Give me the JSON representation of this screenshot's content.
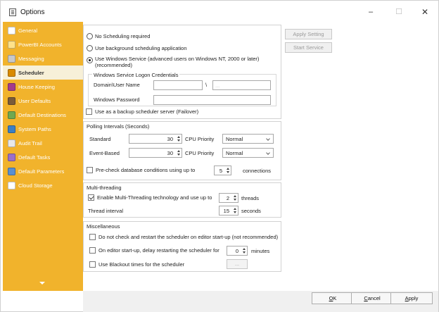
{
  "window": {
    "title": "Options",
    "minimize": "–",
    "maximize": "☐",
    "close": "✕"
  },
  "sidebar": {
    "items": [
      {
        "label": "General",
        "icon": "general-icon",
        "color": "#ffffff"
      },
      {
        "label": "PowerBI Accounts",
        "icon": "powerbi-icon",
        "color": "#ffe28a"
      },
      {
        "label": "Messaging",
        "icon": "messaging-icon",
        "color": "#c8c8c8"
      },
      {
        "label": "Scheduler",
        "icon": "clock-icon",
        "color": "#d98a00"
      },
      {
        "label": "House Keeping",
        "icon": "broom-icon",
        "color": "#a43c8c"
      },
      {
        "label": "User Defaults",
        "icon": "users-icon",
        "color": "#7a5b3a"
      },
      {
        "label": "Default Destinations",
        "icon": "destinations-icon",
        "color": "#6fa850"
      },
      {
        "label": "System Paths",
        "icon": "paths-icon",
        "color": "#3b7fc4"
      },
      {
        "label": "Audit Trail",
        "icon": "audit-icon",
        "color": "#e8e8e8"
      },
      {
        "label": "Default Tasks",
        "icon": "tasks-icon",
        "color": "#9b6fc8"
      },
      {
        "label": "Default Parameters",
        "icon": "parameters-icon",
        "color": "#5a8fd0"
      },
      {
        "label": "Cloud Storage",
        "icon": "cloud-icon",
        "color": "#ffffff"
      }
    ],
    "active": "Scheduler"
  },
  "scheduling": {
    "option_none": "No Scheduling required",
    "option_background": "Use background scheduling application",
    "option_service_line1": "Use Windows Service (advanced users on Windows NT, 2000 or later)",
    "option_service_line2": "(recommended)",
    "selected": "service",
    "credentials_title": "Windows Service Logon Credentials",
    "domain_label": "Domain\\User Name",
    "separator": "\\",
    "ellipsis": "...",
    "password_label": "Windows Password",
    "backup_label": "Use as a backup scheduler server (Failover)"
  },
  "polling": {
    "title": "Polling Intervals (Seconds)",
    "standard_label": "Standard",
    "standard_value": "30",
    "event_label": "Event-Based",
    "event_value": "30",
    "cpu_label": "CPU Priority",
    "standard_priority": "Normal",
    "event_priority": "Normal",
    "precheck_label": "Pre-check database conditions using up to",
    "precheck_value": "5",
    "connections_label": "connections"
  },
  "threading": {
    "title": "Multi-threading",
    "enable_label": "Enable Multi-Threading technology and use up to",
    "enable_checked": true,
    "threads_value": "2",
    "threads_label": "threads",
    "interval_label": "Thread interval",
    "interval_value": "15",
    "seconds_label": "seconds"
  },
  "misc": {
    "title": "Miscellaneous",
    "restart_label": "Do not check and restart the scheduler on editor start-up (not recommended)",
    "delay_label": "On editor start-up, delay restarting the scheduler for",
    "delay_value": "0",
    "minutes_label": "minutes",
    "blackout_label": "Use Blackout times for the scheduler",
    "blackout_button": "..."
  },
  "actions": {
    "apply_setting": "Apply Setting",
    "start_service": "Start Service"
  },
  "footer": {
    "ok_u": "O",
    "ok_rest": "K",
    "cancel_u": "C",
    "cancel_rest": "ancel",
    "apply_u": "A",
    "apply_rest": "pply"
  }
}
